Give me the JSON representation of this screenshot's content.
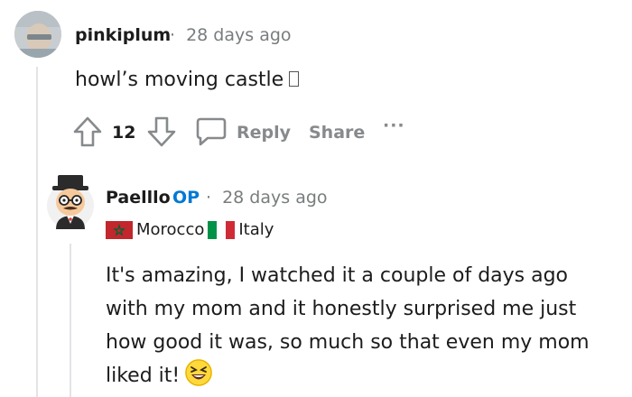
{
  "comment": {
    "username": "pinkiplum",
    "separator": "·",
    "time": "28 days ago",
    "text": "howl’s moving castle",
    "votes": "12",
    "reply_label": "Reply",
    "share_label": "Share",
    "more_label": "···"
  },
  "reply": {
    "username": "Paelllo",
    "op_badge": "OP",
    "separator": "·",
    "time": "28 days ago",
    "flair": {
      "country1": "Morocco",
      "country2": "Italy"
    },
    "lines": [
      "It's amazing, I watched it a couple of days ago",
      "with my mom and it honestly surprised me just",
      "how good it was, so much so that even my mom",
      "liked it!"
    ]
  },
  "colors": {
    "op": "#0079d3",
    "muted": "#787c7e",
    "action": "#878a8c",
    "emoji": "#ffd93b"
  },
  "icons": [
    "upvote-icon",
    "downvote-icon",
    "comment-icon",
    "more-icon",
    "laughing-emoji-icon"
  ]
}
